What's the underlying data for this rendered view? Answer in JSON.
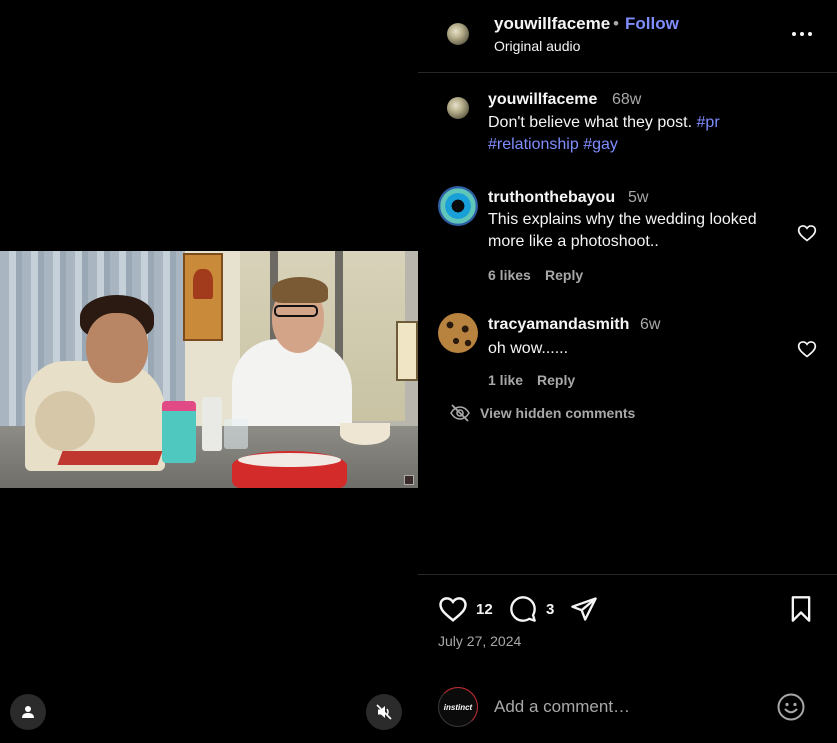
{
  "post": {
    "username": "youwillfaceme",
    "follow_label": "Follow",
    "separator": "•",
    "audio": "Original audio",
    "caption_time": "68w",
    "caption_text": "Don't believe what they post.",
    "caption_tags": [
      "#pr",
      "#relationship",
      "#gay"
    ]
  },
  "comments": [
    {
      "username": "truthonthebayou",
      "time": "5w",
      "text": "This explains why the wedding looked more like a photoshoot..",
      "likes": "6 likes",
      "reply": "Reply",
      "avatar": "eye-avatar"
    },
    {
      "username": "tracyamandasmith",
      "time": "6w",
      "text": "oh wow......",
      "likes": "1 like",
      "reply": "Reply",
      "avatar": "leopard-avatar"
    }
  ],
  "hidden_comments_label": "View hidden comments",
  "actions": {
    "like_count": "12",
    "comment_count": "3",
    "date": "July 27, 2024"
  },
  "add_comment": {
    "placeholder": "Add a comment…",
    "avatar_text": "instinct"
  },
  "icons": {
    "header_more": "more-horizontal-icon",
    "like": "heart-icon",
    "comment": "comment-bubble-icon",
    "share": "paper-plane-icon",
    "save": "bookmark-icon",
    "hidden": "eye-slash-icon",
    "emoji": "smiley-icon",
    "profile": "user-icon",
    "mute": "speaker-muted-icon"
  },
  "colors": {
    "accent_link": "#7f8dff",
    "text_primary": "#f5f5f5",
    "text_secondary": "#a8a8a8",
    "background": "#000000",
    "divider": "#262626"
  }
}
